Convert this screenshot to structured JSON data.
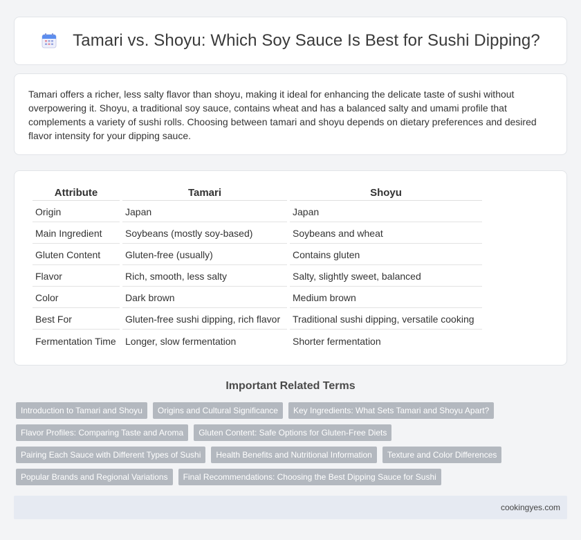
{
  "header": {
    "title": "Tamari vs. Shoyu: Which Soy Sauce Is Best for Sushi Dipping?",
    "icon": "calendar-icon"
  },
  "intro": {
    "text": "Tamari offers a richer, less salty flavor than shoyu, making it ideal for enhancing the delicate taste of sushi without overpowering it. Shoyu, a traditional soy sauce, contains wheat and has a balanced salty and umami profile that complements a variety of sushi rolls. Choosing between tamari and shoyu depends on dietary preferences and desired flavor intensity for your dipping sauce."
  },
  "table": {
    "headers": [
      "Attribute",
      "Tamari",
      "Shoyu"
    ],
    "rows": [
      [
        "Origin",
        "Japan",
        "Japan"
      ],
      [
        "Main Ingredient",
        "Soybeans (mostly soy-based)",
        "Soybeans and wheat"
      ],
      [
        "Gluten Content",
        "Gluten-free (usually)",
        "Contains gluten"
      ],
      [
        "Flavor",
        "Rich, smooth, less salty",
        "Salty, slightly sweet, balanced"
      ],
      [
        "Color",
        "Dark brown",
        "Medium brown"
      ],
      [
        "Best For",
        "Gluten-free sushi dipping, rich flavor",
        "Traditional sushi dipping, versatile cooking"
      ],
      [
        "Fermentation Time",
        "Longer, slow fermentation",
        "Shorter fermentation"
      ]
    ]
  },
  "related": {
    "heading": "Important Related Terms",
    "tags": [
      "Introduction to Tamari and Shoyu",
      "Origins and Cultural Significance",
      "Key Ingredients: What Sets Tamari and Shoyu Apart?",
      "Flavor Profiles: Comparing Taste and Aroma",
      "Gluten Content: Safe Options for Gluten-Free Diets",
      "Pairing Each Sauce with Different Types of Sushi",
      "Health Benefits and Nutritional Information",
      "Texture and Color Differences",
      "Popular Brands and Regional Variations",
      "Final Recommendations: Choosing the Best Dipping Sauce for Sushi"
    ]
  },
  "footer": {
    "site": "cookingyes.com"
  },
  "colors": {
    "background": "#f3f4f6",
    "tag": "#b3b8bf",
    "footer": "#e6eaf2",
    "icon_header": "#5b8def",
    "icon_grid": "#e48fa0"
  }
}
